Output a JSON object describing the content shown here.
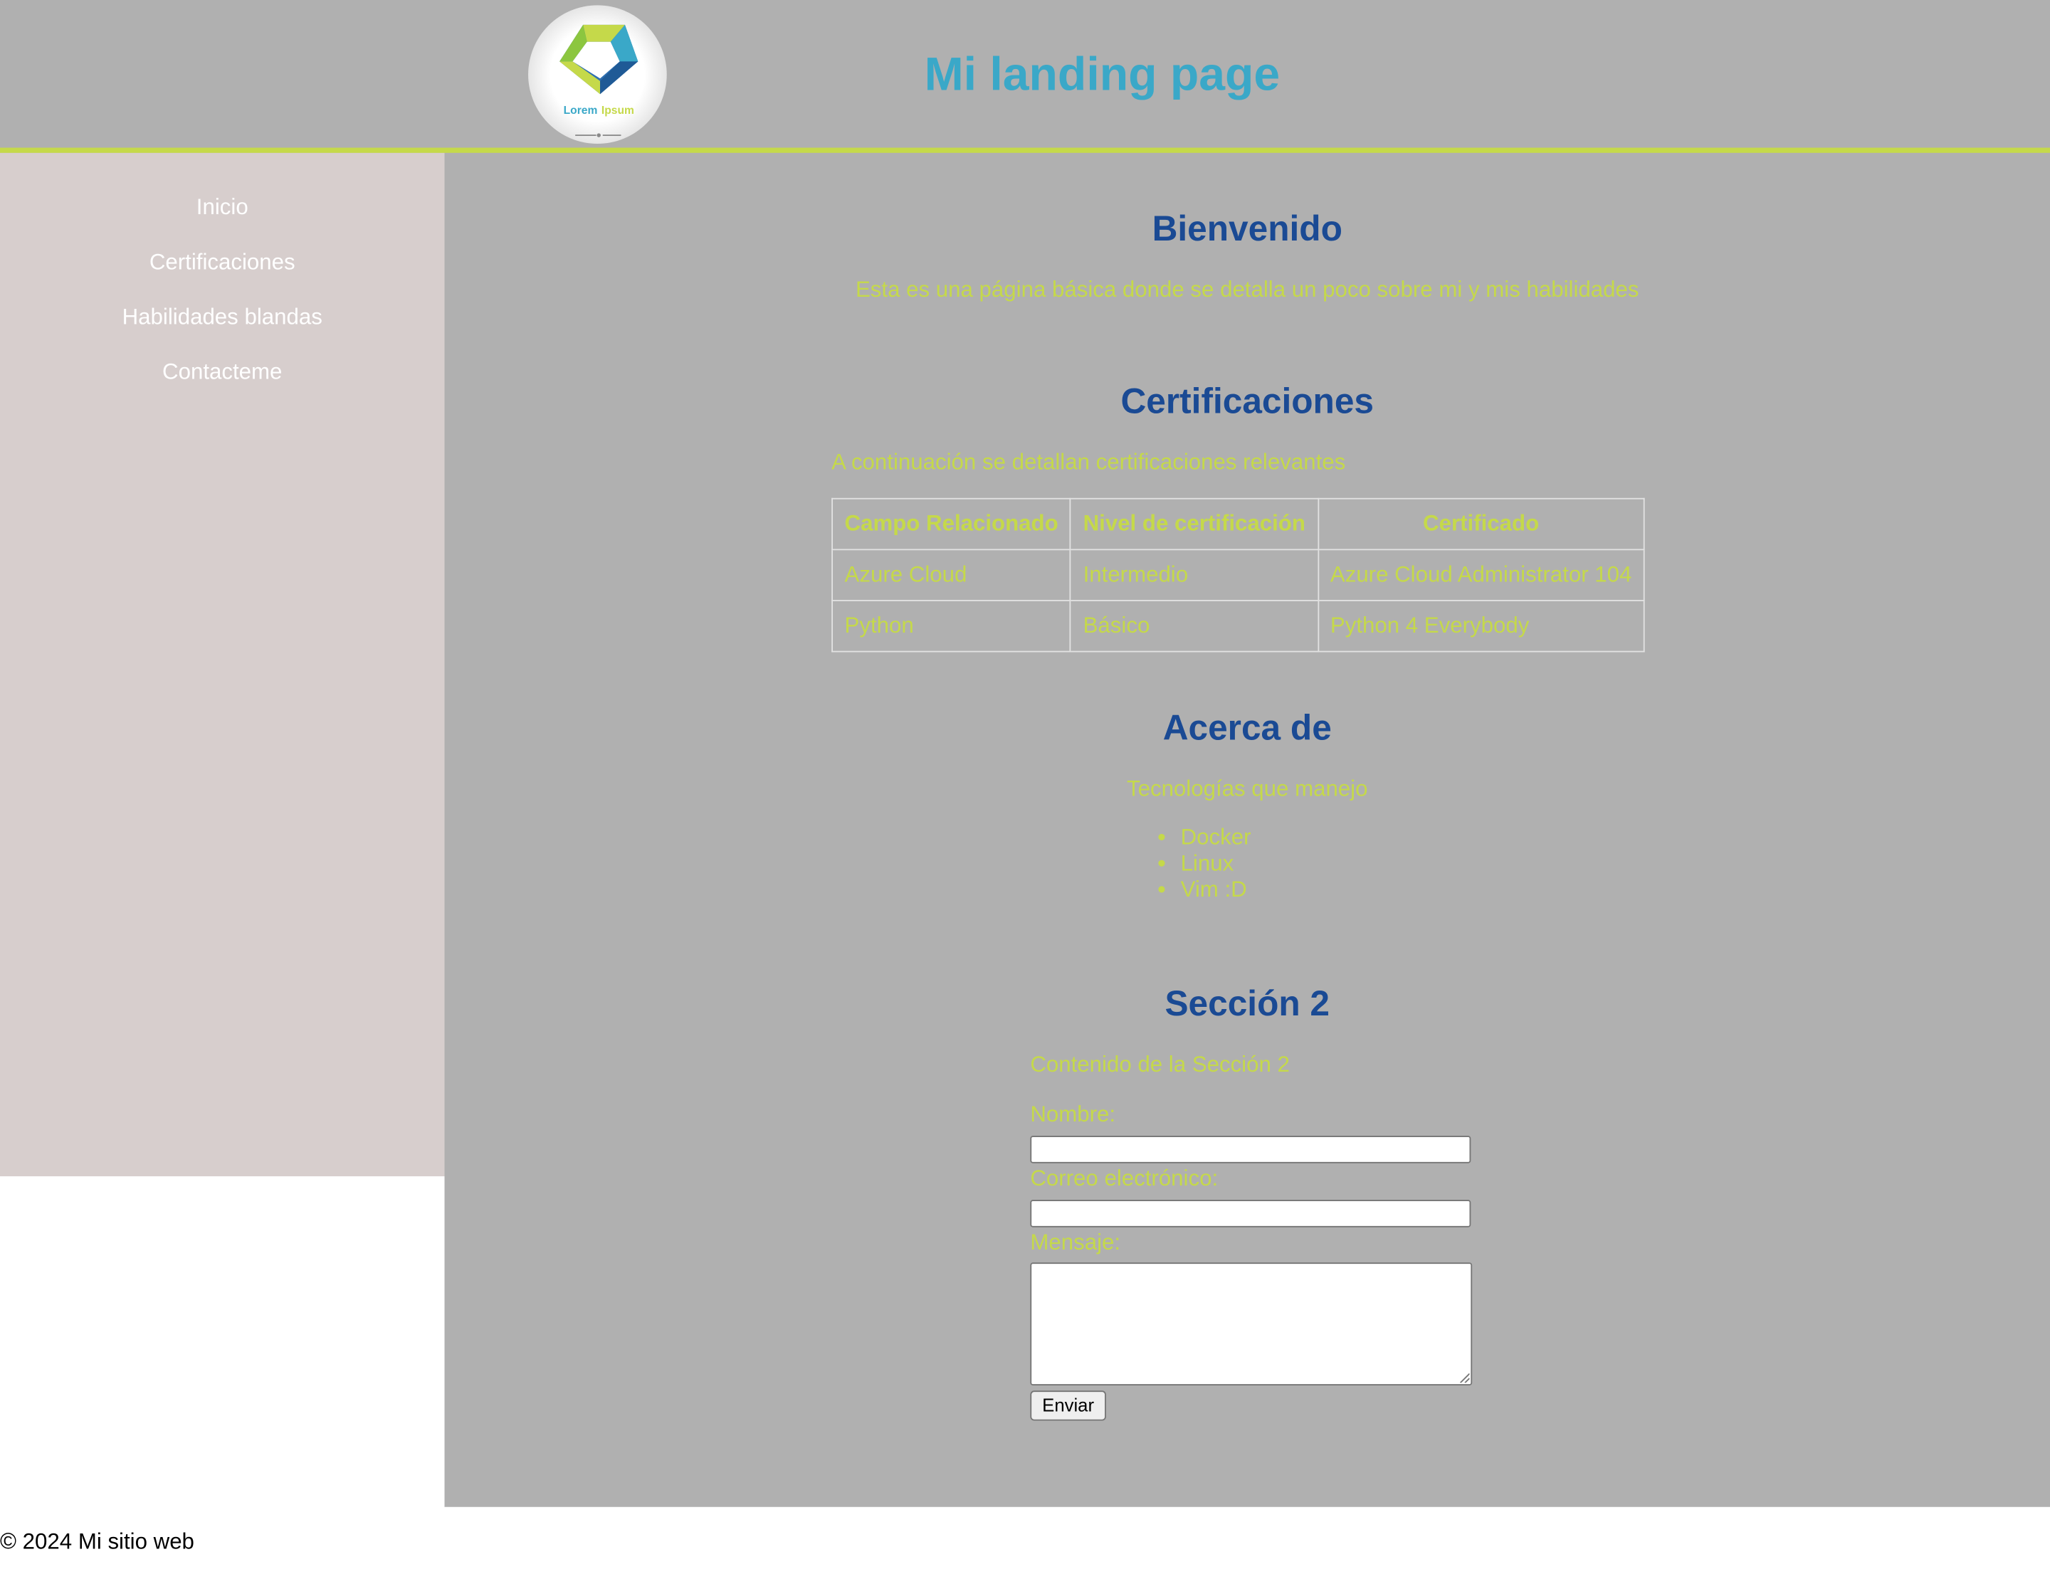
{
  "header": {
    "title": "Mi landing page",
    "logo_text_1": "Lorem",
    "logo_text_2": "Ipsum"
  },
  "nav": [
    {
      "label": "Inicio"
    },
    {
      "label": "Certificaciones"
    },
    {
      "label": "Habilidades blandas"
    },
    {
      "label": "Contacteme"
    }
  ],
  "welcome": {
    "title": "Bienvenido",
    "text": "Esta es una página básica donde se detalla un poco sobre mi y mis habilidades"
  },
  "certifications": {
    "title": "Certificaciones",
    "intro": "A continuación se detallan certificaciones relevantes",
    "columns": [
      "Campo Relacionado",
      "Nivel de certificación",
      "Certificado"
    ],
    "rows": [
      [
        "Azure Cloud",
        "Intermedio",
        "Azure Cloud Administrator 104"
      ],
      [
        "Python",
        "Básico",
        "Python 4 Everybody"
      ]
    ]
  },
  "about": {
    "title": "Acerca de",
    "subtitle": "Tecnologías que manejo",
    "items": [
      "Docker",
      "Linux",
      "Vim :D"
    ]
  },
  "section2": {
    "title": "Sección 2",
    "text": "Contenido de la Sección 2",
    "name_label": "Nombre:",
    "email_label": "Correo electrónico:",
    "message_label": "Mensaje:",
    "submit_label": "Enviar"
  },
  "footer": {
    "text": "© 2024 Mi sitio web"
  },
  "colors": {
    "header_bg": "#b0b0b0",
    "accent_green": "#c5d94a",
    "title_cyan": "#3aa8c8",
    "heading_blue": "#1a4a94",
    "sidebar_bg": "#d7cecd"
  }
}
